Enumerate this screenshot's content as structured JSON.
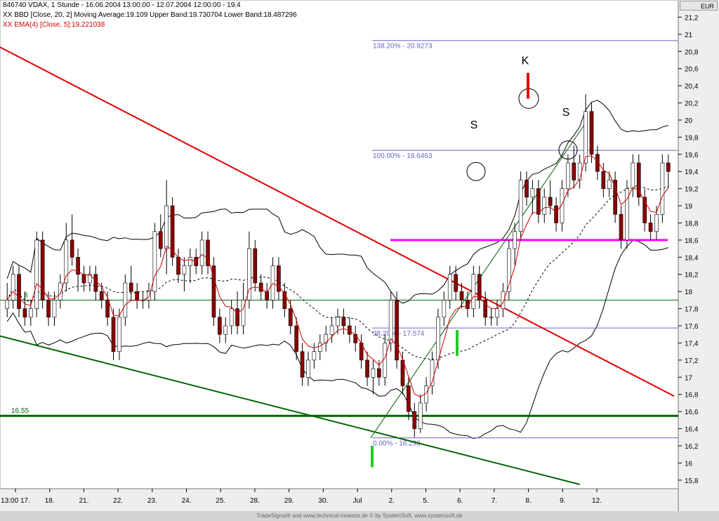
{
  "header": {
    "line1": "846740  VDAX, 1 Stunde - 16.06.2004 13:00:00 - 12.07.2004 12:00:00 - 19.4",
    "line2": "BBD [Close, 20, 2] Moving Average:19.109 Upper Band:19.730704 Lower Band:18.487296",
    "line3": "EMA(4) [Close, 5]:19.221038",
    "line2_marker": "XX",
    "line3_marker": "XX",
    "currency": "EUR"
  },
  "footer": {
    "credit": "TradeSignal® and www.technical-investor.de © by SystemSoft, www.systemsoft.de"
  },
  "colors": {
    "candle_up": "#ffffff",
    "candle_down": "#8b0000",
    "ema": "#cc0000",
    "bands": "#000000",
    "downtrend": "#e00000",
    "lower_trend": "#006400",
    "support": "#006400",
    "neckline": "#ff00ff",
    "fib": "#6666cc",
    "marker_red": "#e00000",
    "marker_green": "#22cc22"
  },
  "chart_data": {
    "type": "candlestick",
    "title": "846740  VDAX, 1 Stunde - 16.06.2004 13:00:00 - 12.07.2004 12:00:00 - 19.4",
    "ylim": [
      15.7,
      21.4
    ],
    "y_ticks": [
      "15,8",
      "16",
      "16,2",
      "16,4",
      "16,6",
      "16,8",
      "17",
      "17,2",
      "17,4",
      "17,6",
      "17,8",
      "18",
      "18,2",
      "18,4",
      "18,6",
      "18,8",
      "19",
      "19,2",
      "19,4",
      "19,6",
      "19,8",
      "20",
      "20,2",
      "20,4",
      "20,6",
      "20,8",
      "21",
      "21,2"
    ],
    "x_ticks": [
      "13:00 17.",
      "18.",
      "21.",
      "22.",
      "23.",
      "24.",
      "25.",
      "28.",
      "29.",
      "30.",
      "Jul",
      "2.",
      "5.",
      "6.",
      "7.",
      "8.",
      "9.",
      "12."
    ],
    "grid": false,
    "candles_hourly": [
      [
        17.8,
        18.1,
        17.7,
        17.9
      ],
      [
        17.9,
        18.3,
        17.8,
        18.2
      ],
      [
        18.2,
        18.3,
        17.7,
        17.8
      ],
      [
        17.8,
        18.0,
        17.6,
        17.7
      ],
      [
        17.7,
        17.9,
        17.6,
        17.8
      ],
      [
        17.8,
        18.7,
        17.7,
        18.6
      ],
      [
        18.6,
        18.7,
        17.8,
        17.9
      ],
      [
        17.9,
        18.0,
        17.6,
        17.7
      ],
      [
        17.7,
        18.0,
        17.6,
        17.9
      ],
      [
        17.9,
        18.2,
        17.8,
        18.1
      ],
      [
        18.1,
        18.8,
        18.0,
        18.6
      ],
      [
        18.6,
        18.9,
        18.3,
        18.4
      ],
      [
        18.4,
        18.5,
        18.0,
        18.2
      ],
      [
        18.2,
        18.3,
        18.0,
        18.1
      ],
      [
        18.1,
        18.3,
        18.0,
        18.2
      ],
      [
        18.2,
        18.3,
        17.9,
        18.0
      ],
      [
        18.0,
        18.1,
        17.8,
        17.9
      ],
      [
        17.9,
        18.0,
        17.6,
        17.7
      ],
      [
        17.7,
        17.8,
        17.2,
        17.3
      ],
      [
        17.3,
        17.8,
        17.2,
        17.7
      ],
      [
        17.7,
        18.2,
        17.6,
        18.1
      ],
      [
        18.1,
        18.3,
        17.9,
        18.0
      ],
      [
        18.0,
        18.1,
        17.8,
        17.9
      ],
      [
        17.9,
        18.0,
        17.8,
        17.9
      ],
      [
        17.9,
        18.1,
        17.8,
        18.0
      ],
      [
        18.0,
        18.8,
        17.9,
        18.7
      ],
      [
        18.7,
        18.9,
        18.4,
        18.5
      ],
      [
        18.5,
        19.3,
        18.2,
        19.0
      ],
      [
        19.0,
        19.1,
        18.3,
        18.4
      ],
      [
        18.4,
        18.5,
        18.1,
        18.2
      ],
      [
        18.2,
        18.4,
        18.0,
        18.3
      ],
      [
        18.3,
        18.5,
        18.1,
        18.4
      ],
      [
        18.4,
        18.5,
        18.2,
        18.3
      ],
      [
        18.3,
        18.7,
        18.2,
        18.6
      ],
      [
        18.6,
        18.7,
        18.2,
        18.3
      ],
      [
        18.3,
        18.4,
        17.6,
        17.7
      ],
      [
        17.7,
        17.8,
        17.4,
        17.5
      ],
      [
        17.5,
        17.7,
        17.4,
        17.6
      ],
      [
        17.6,
        17.9,
        17.5,
        17.8
      ],
      [
        17.8,
        18.0,
        17.5,
        17.6
      ],
      [
        17.6,
        18.1,
        17.5,
        17.9
      ],
      [
        17.9,
        18.7,
        17.8,
        18.5
      ],
      [
        18.5,
        18.6,
        18.0,
        18.1
      ],
      [
        18.1,
        18.2,
        17.9,
        18.0
      ],
      [
        18.0,
        18.1,
        17.8,
        17.9
      ],
      [
        17.9,
        18.4,
        17.8,
        18.3
      ],
      [
        18.3,
        18.4,
        17.9,
        18.0
      ],
      [
        18.0,
        18.1,
        17.7,
        17.8
      ],
      [
        17.8,
        17.9,
        17.5,
        17.6
      ],
      [
        17.6,
        17.7,
        17.2,
        17.3
      ],
      [
        17.3,
        17.4,
        16.9,
        17.0
      ],
      [
        17.0,
        17.3,
        16.9,
        17.2
      ],
      [
        17.2,
        17.4,
        17.1,
        17.3
      ],
      [
        17.3,
        17.5,
        17.2,
        17.4
      ],
      [
        17.4,
        17.6,
        17.3,
        17.5
      ],
      [
        17.5,
        17.7,
        17.4,
        17.6
      ],
      [
        17.6,
        17.8,
        17.5,
        17.7
      ],
      [
        17.7,
        17.8,
        17.5,
        17.6
      ],
      [
        17.6,
        17.7,
        17.4,
        17.5
      ],
      [
        17.5,
        17.6,
        17.3,
        17.4
      ],
      [
        17.4,
        17.5,
        17.1,
        17.2
      ],
      [
        17.2,
        17.3,
        16.9,
        17.0
      ],
      [
        17.0,
        17.2,
        16.8,
        17.1
      ],
      [
        17.1,
        17.2,
        16.9,
        17.0
      ],
      [
        17.0,
        17.5,
        16.9,
        17.4
      ],
      [
        17.4,
        18.0,
        17.3,
        17.9
      ],
      [
        17.9,
        18.0,
        17.1,
        17.2
      ],
      [
        17.2,
        17.3,
        16.8,
        16.9
      ],
      [
        16.9,
        17.0,
        16.5,
        16.6
      ],
      [
        16.6,
        16.7,
        16.3,
        16.4
      ],
      [
        16.4,
        16.8,
        16.35,
        16.7
      ],
      [
        16.7,
        17.0,
        16.6,
        16.9
      ],
      [
        16.9,
        17.3,
        16.8,
        17.2
      ],
      [
        17.2,
        17.8,
        17.1,
        17.7
      ],
      [
        17.7,
        18.0,
        17.6,
        17.9
      ],
      [
        17.9,
        18.3,
        17.8,
        18.2
      ],
      [
        18.2,
        18.3,
        17.9,
        18.0
      ],
      [
        18.0,
        18.1,
        17.8,
        17.9
      ],
      [
        17.9,
        18.0,
        17.7,
        17.8
      ],
      [
        17.8,
        18.3,
        17.7,
        18.2
      ],
      [
        18.2,
        18.3,
        17.8,
        17.9
      ],
      [
        17.9,
        18.0,
        17.6,
        17.7
      ],
      [
        17.7,
        17.8,
        17.6,
        17.7
      ],
      [
        17.7,
        17.9,
        17.6,
        17.8
      ],
      [
        17.8,
        18.1,
        17.7,
        18.0
      ],
      [
        18.0,
        18.6,
        17.9,
        18.5
      ],
      [
        18.5,
        18.8,
        18.3,
        18.7
      ],
      [
        18.7,
        19.4,
        18.6,
        19.3
      ],
      [
        19.3,
        19.4,
        19.0,
        19.1
      ],
      [
        19.1,
        19.3,
        18.9,
        19.2
      ],
      [
        19.2,
        19.3,
        18.8,
        18.9
      ],
      [
        18.9,
        19.2,
        18.8,
        19.1
      ],
      [
        19.1,
        19.3,
        18.9,
        19.0
      ],
      [
        19.0,
        19.1,
        18.7,
        18.8
      ],
      [
        18.8,
        19.3,
        18.7,
        19.2
      ],
      [
        19.2,
        19.6,
        19.1,
        19.5
      ],
      [
        19.5,
        19.7,
        19.2,
        19.3
      ],
      [
        19.3,
        19.6,
        19.2,
        19.5
      ],
      [
        19.5,
        20.3,
        19.4,
        20.1
      ],
      [
        20.1,
        20.2,
        19.5,
        19.6
      ],
      [
        19.6,
        19.7,
        19.3,
        19.4
      ],
      [
        19.4,
        19.5,
        19.1,
        19.2
      ],
      [
        19.2,
        19.4,
        19.1,
        19.3
      ],
      [
        19.3,
        19.4,
        18.8,
        18.9
      ],
      [
        18.9,
        19.0,
        18.5,
        18.6
      ],
      [
        18.6,
        19.3,
        18.5,
        19.2
      ],
      [
        19.2,
        19.6,
        19.1,
        19.5
      ],
      [
        19.5,
        19.6,
        19.0,
        19.1
      ],
      [
        19.1,
        19.2,
        18.7,
        18.8
      ],
      [
        18.8,
        18.9,
        18.6,
        18.7
      ],
      [
        18.7,
        19.0,
        18.6,
        18.9
      ],
      [
        18.9,
        19.6,
        18.8,
        19.5
      ],
      [
        19.5,
        19.6,
        19.2,
        19.4
      ]
    ],
    "series": [
      {
        "name": "BBD [Close, 20, 2]",
        "values": {
          "moving_average": 19.109,
          "upper_band": 19.730704,
          "lower_band": 18.487296
        }
      },
      {
        "name": "EMA(4) [Close, 5]",
        "values": {
          "last": 19.221038
        }
      }
    ],
    "horizontal_lines": [
      {
        "name": "support",
        "y": 16.55,
        "label": "16.55"
      },
      {
        "name": "neckline",
        "y": 18.6
      },
      {
        "name": "mid-support",
        "y": 17.9,
        "label": "8"
      }
    ],
    "fibonacci": [
      {
        "label": "138.20% - 20.9273",
        "y": 20.9273
      },
      {
        "label": "100.00% - 19.6463",
        "y": 19.6463
      },
      {
        "label": "38.20% - 17.574",
        "y": 17.574
      },
      {
        "label": "0.00% - 16.293",
        "y": 16.293
      }
    ],
    "trendlines": [
      {
        "name": "downtrend",
        "points": [
          [
            0,
            20.85
          ],
          [
            1.0,
            16.78
          ]
        ]
      },
      {
        "name": "lower-trend",
        "points": [
          [
            0,
            17.48
          ],
          [
            0.86,
            15.75
          ]
        ]
      },
      {
        "name": "uptrend",
        "points": [
          [
            0.55,
            16.293
          ],
          [
            0.87,
            19.98
          ]
        ]
      }
    ],
    "annotations": [
      {
        "text": "S",
        "x_hint": "6.",
        "y": 19.9
      },
      {
        "text": "K",
        "x_hint": "8.",
        "y": 20.65
      },
      {
        "text": "S",
        "x_hint": "9.",
        "y": 20.05
      }
    ]
  }
}
